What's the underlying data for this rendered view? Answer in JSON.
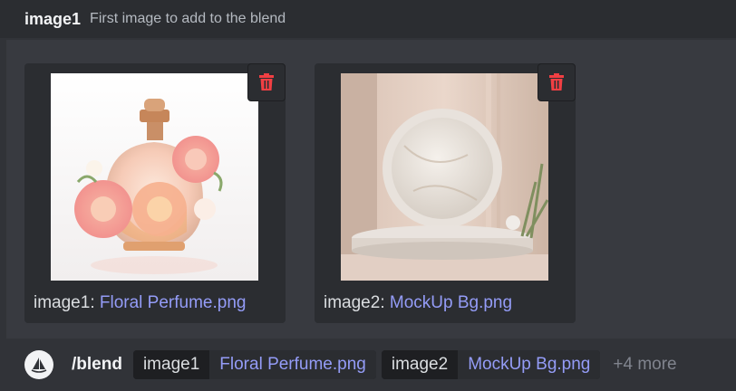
{
  "option": {
    "name": "image1",
    "description": "First image to add to the blend"
  },
  "attachments": [
    {
      "label_prefix": "image1: ",
      "filename": "Floral Perfume.png",
      "delete_icon": "trash-icon"
    },
    {
      "label_prefix": "image2: ",
      "filename": "MockUp Bg.png",
      "delete_icon": "trash-icon"
    }
  ],
  "command_bar": {
    "bot_icon": "sailboat-icon",
    "command": "/blend",
    "params": [
      {
        "name": "image1",
        "value": "Floral Perfume.png"
      },
      {
        "name": "image2",
        "value": "MockUp Bg.png"
      }
    ],
    "more": "+4 more"
  },
  "colors": {
    "background": "#313338",
    "link": "#949cf7",
    "danger": "#f23f43"
  }
}
